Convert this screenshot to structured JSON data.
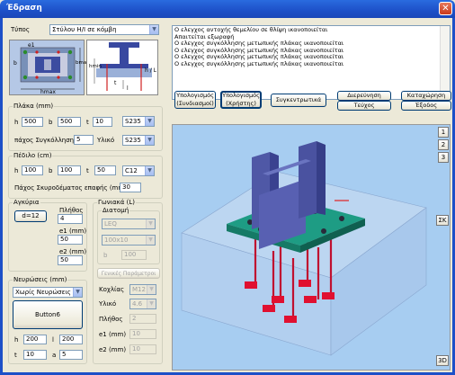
{
  "window": {
    "title": "Έδραση"
  },
  "type": {
    "label": "Τύπος",
    "value": "Στύλου Η/Ι σε κόμβη"
  },
  "diagram": {
    "e1": "e1",
    "b": "b",
    "bmax": "bmax",
    "hmax": "hmax",
    "hmin": "hmin",
    "hL": "h / L",
    "t": "t",
    "l": "l"
  },
  "plate": {
    "title": "Πλάκα (mm)",
    "h_label": "h",
    "h": "500",
    "b_label": "b",
    "b": "500",
    "t_label": "t",
    "t": "10",
    "steel": "S235",
    "weld_label": "πάχος Συγκόλλησης",
    "weld": "5",
    "material_label": "Υλικό",
    "material": "S235"
  },
  "pedestal": {
    "title": "Πέδιλο (cm)",
    "h_label": "h",
    "h": "100",
    "b_label": "b",
    "b": "100",
    "t_label": "t",
    "t": "50",
    "concrete": "C12",
    "grout_label": "Πάχος Σκυροδέματος επαφής (mm)",
    "grout": "30"
  },
  "anchors": {
    "title": "Αγκύρια",
    "size": "d=12",
    "count_label": "Πλήθος",
    "count": "4",
    "e1_label": "e1 (mm)",
    "e1": "50",
    "e2_label": "e2 (mm)",
    "e2": "50"
  },
  "angles": {
    "title": "Γωνιακά (L)",
    "section_title": "Διατομή",
    "type": "LEQ",
    "size": "100x10",
    "b_label": "b",
    "b": "100",
    "general_button": "Γενικές Παράμετροι",
    "bolt_label": "Κοχλίας",
    "bolt": "M12",
    "bmaterial_label": "Υλικό",
    "bmaterial": "4.6",
    "count_label": "Πλήθος",
    "count": "2",
    "e1_label": "e1 (mm)",
    "e1": "10",
    "e2_label": "e2 (mm)",
    "e2": "10"
  },
  "ribs": {
    "title": "Νευρώσεις (mm)",
    "type": "Χωρίς Νευρώσεις",
    "button": "Button6",
    "h_label": "h",
    "h": "200",
    "l_label": "l",
    "l": "200",
    "t_label": "t",
    "t": "10",
    "a_label": "a",
    "a": "5"
  },
  "messages": [
    "Ο ελεγχος αντοχής θεμελίου σε θλίψη ικανοποιείται",
    "Απαιτείται εξωραφή",
    "Ο ελεγχος  συγκόλλησης μετωπικής πλάκας ικανοποιείται",
    "Ο ελεγχος  συγκόλλησης μετωπικής πλάκας ικανοποιείται",
    "Ο ελεγχος  συγκόλλησης μετωπικής πλάκας ικανοποιείται",
    "Ο ελεγχος  συγκόλλησης μετωπικής πλάκας ικανοποιείται"
  ],
  "toolbar": {
    "calc_combined": "Υπολογισμός (Συνδιασμοί)",
    "calc_user": "Υπολογισμός (Χρήστης)",
    "summary": "Συγκεντρωτικά",
    "investigation": "Διερεύνηση",
    "report": "Τεύχος",
    "register": "Καταχώρηση",
    "exit": "Έξοδος"
  },
  "side_buttons": {
    "b1": "1",
    "b2": "2",
    "b3": "3",
    "sk": "ΣΚ",
    "view3d": "3D"
  }
}
